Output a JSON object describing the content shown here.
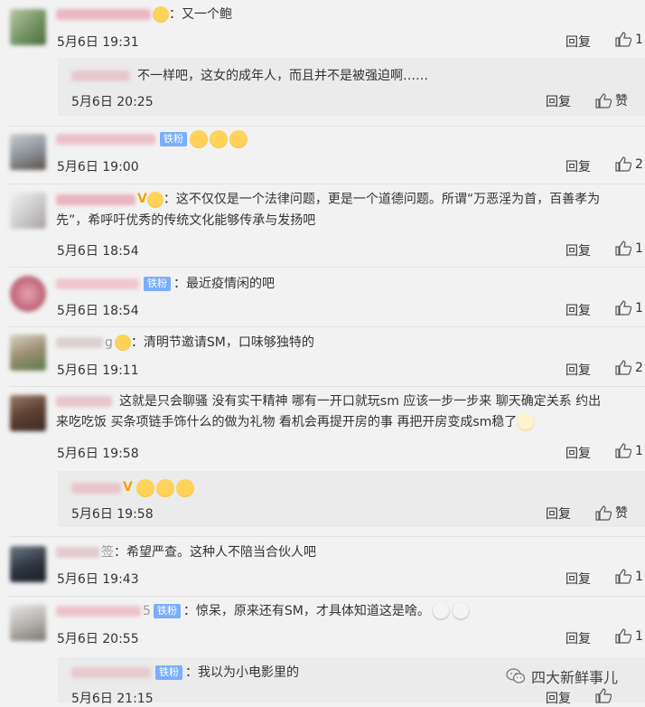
{
  "comments": [
    {
      "text": "：又一个鲍",
      "time": "5月6日 19:31",
      "reply": "回复",
      "likes": "1"
    },
    {
      "text": "不一样吧，这女的成年人，而且并不是被强迫啊……",
      "time": "5月6日 20:25",
      "reply": "回复",
      "likes": "赞"
    },
    {
      "badge": "铁粉",
      "text": "",
      "time": "5月6日 19:00",
      "reply": "回复",
      "likes": "2"
    },
    {
      "text_line1": "：这不仅仅是一个法律问题，更是一个道德问题。所谓“万恶淫为首，百善孝为",
      "text_line2": "先”，希呼吁优秀的传统文化能够传承与发扬吧",
      "time": "5月6日 18:54",
      "reply": "回复",
      "likes": "1"
    },
    {
      "badge": "铁粉",
      "text": "：最近疫情闲的吧",
      "time": "5月6日 18:54",
      "reply": "回复",
      "likes": "1"
    },
    {
      "name_frag": "g",
      "text": "：清明节邀请SM，口味够独特的",
      "time": "5月6日 19:11",
      "reply": "回复",
      "likes": "2"
    },
    {
      "text_line1": "这就是只会聊骚 没有实干精神 哪有一开口就玩sm 应该一步一步来 聊天确定关系 约出",
      "text_line2": "来吃吃饭 买条项链手饰什么的做为礼物 看机会再提开房的事 再把开房变成sm稳了",
      "time": "5月6日 19:58",
      "reply": "回复",
      "likes": "1"
    },
    {
      "text": "",
      "time": "5月6日 19:58",
      "reply": "回复",
      "likes": "赞"
    },
    {
      "name_frag": "签",
      "text": "：希望严查。这种人不陪当合伙人吧",
      "time": "5月6日 19:43",
      "reply": "回复",
      "likes": "1"
    },
    {
      "name_frag": "5",
      "badge": "铁粉",
      "text": "：惊呆，原来还有SM，才具体知道这是啥。",
      "time": "5月6日 20:55",
      "reply": "回复",
      "likes": "1"
    },
    {
      "badge": "铁粉",
      "text": "：我以为小电影里的",
      "time": "5月6日 21:15",
      "reply": "回复",
      "likes": ""
    }
  ],
  "watermark": "四大新鲜事儿",
  "colors": {
    "background": "#f2f2f2",
    "reply_box": "#ebebeb",
    "badge": "#78aefc",
    "separator": "#e2e2e2"
  }
}
